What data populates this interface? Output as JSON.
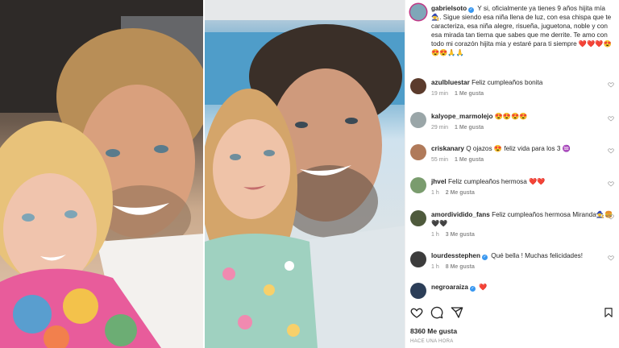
{
  "caption": {
    "username": "gabrielsoto",
    "text": "Y si, oficialmente ya tienes 9 años hijita mía 🧙‍♀️. Sigue siendo esa niña llena de luz, con esa chispa que te caracteriza, esa niña alegre, risueña, juguetona, noble y con esa mirada tan tierna que sabes que me derrite. Te amo con todo mi corazón hijita mia y estaré para ti siempre ❤️❤️❤️😍😍😍🙏🙏",
    "emoji_tail": "🙏🙏"
  },
  "comments": [
    {
      "username": "azulbluestar",
      "verified": false,
      "text": "Feliz cumpleaños bonita",
      "time": "19 min",
      "likes": "1 Me gusta",
      "reply": "",
      "avatar_color": "#5b3b2c"
    },
    {
      "username": "kalyope_marmolejo",
      "verified": false,
      "text": "😍😍😍😍",
      "time": "29 min",
      "likes": "1 Me gusta",
      "reply": "",
      "avatar_color": "#9aa6a8"
    },
    {
      "username": "criskanary",
      "verified": false,
      "text": "Q ojazos 😍 feliz vida para los 3 ♒",
      "time": "55 min",
      "likes": "1 Me gusta",
      "reply": "",
      "avatar_color": "#b07a5a"
    },
    {
      "username": "jhvel",
      "verified": false,
      "text": "Feliz cumpleaños hermosa ❤️❤️",
      "time": "1 h",
      "likes": "2 Me gusta",
      "reply": "",
      "avatar_color": "#7a9c6e"
    },
    {
      "username": "amordividido_fans",
      "verified": false,
      "text": "Feliz cumpleaños hermosa Miranda🧙‍♀️🍔🖤🖤",
      "time": "1 h",
      "likes": "3 Me gusta",
      "reply": "",
      "avatar_color": "#4e5a3c"
    },
    {
      "username": "lourdesstephen",
      "verified": true,
      "text": "Qué bella ! Muchas felicidades!",
      "time": "1 h",
      "likes": "8 Me gusta",
      "reply": "",
      "avatar_color": "#3c3c3c"
    },
    {
      "username": "negroaraiza",
      "verified": true,
      "text": "❤️",
      "time": "",
      "likes": "",
      "reply": "",
      "avatar_color": "#2c3e58"
    }
  ],
  "caption_meta": {
    "tone": "🙏🙏"
  },
  "footer": {
    "likes": "8360 Me gusta",
    "timestamp": "HACE UNA HORA"
  },
  "icons": [
    "heart-icon",
    "comment-icon",
    "share-icon",
    "bookmark-icon",
    "verified-icon"
  ],
  "colors": {
    "verified": "#3897f0",
    "muted": "#8e8e8e",
    "text": "#262626"
  }
}
